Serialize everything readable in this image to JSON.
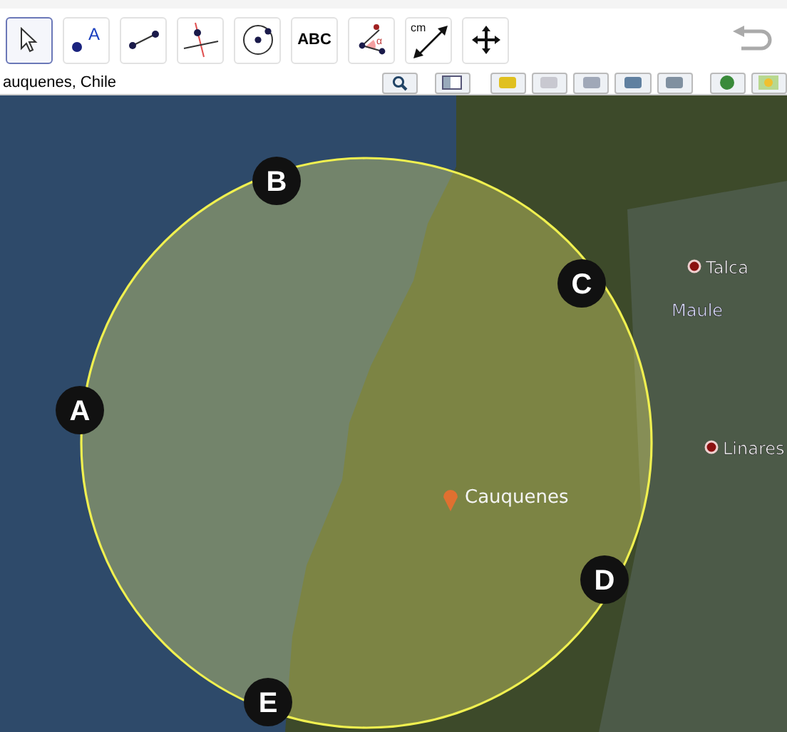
{
  "toolbar": {
    "tools": [
      {
        "kind": "move",
        "selected": true
      },
      {
        "kind": "point",
        "label": "A",
        "selected": false
      },
      {
        "kind": "segment",
        "selected": false
      },
      {
        "kind": "perpendicular",
        "selected": false
      },
      {
        "kind": "circle",
        "selected": false
      },
      {
        "kind": "text",
        "label": "ABC",
        "selected": false
      },
      {
        "kind": "angle",
        "label": "α",
        "selected": false
      },
      {
        "kind": "distance",
        "label": "cm",
        "selected": false
      },
      {
        "kind": "pan",
        "selected": false
      }
    ]
  },
  "search": {
    "value": "auquenes, Chile"
  },
  "map": {
    "places": [
      {
        "kind": "city",
        "name": "Talca"
      },
      {
        "kind": "region",
        "name": "Maule"
      },
      {
        "kind": "city",
        "name": "Linares"
      },
      {
        "kind": "pin",
        "name": "Cauquenes"
      }
    ],
    "markers": [
      {
        "label": "A"
      },
      {
        "label": "B"
      },
      {
        "label": "C"
      },
      {
        "label": "D"
      },
      {
        "label": "E"
      }
    ]
  }
}
